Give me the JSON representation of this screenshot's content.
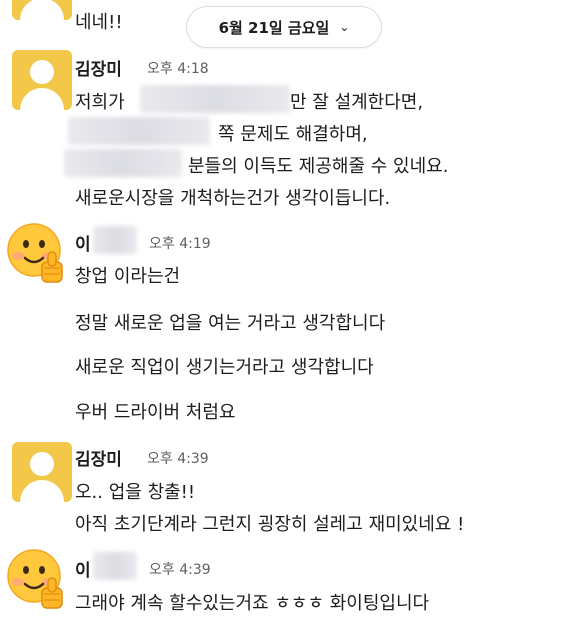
{
  "date_divider": {
    "label": "6월 21일 금요일"
  },
  "messages": [
    {
      "author": "",
      "time": "",
      "lines": [
        "네네!!"
      ]
    },
    {
      "author": "김장미",
      "time": "오후 4:18",
      "lines": [
        "저희가",
        "만 잘 설계한다면,",
        "쪽 문제도 해결하며,",
        "분들의 이득도 제공해줄 수 있네요.",
        "새로운시장을 개척하는건가 생각이듭니다."
      ]
    },
    {
      "author": "이",
      "time": "오후 4:19",
      "lines": [
        "창업 이라는건",
        "정말 새로운 업을 여는 거라고 생각합니다",
        "새로운 직업이 생기는거라고 생각합니다",
        "우버 드라이버 처럼요"
      ]
    },
    {
      "author": "김장미",
      "time": "오후 4:39",
      "lines": [
        "오.. 업을 창출!!",
        "아직 초기단계라 그런지 굉장히 설레고 재미있네요 !"
      ]
    },
    {
      "author": "이",
      "time": "오후 4:39",
      "lines": [
        "그래야 계속 할수있는거죠 ㅎㅎㅎ 화이팅입니다"
      ]
    }
  ]
}
